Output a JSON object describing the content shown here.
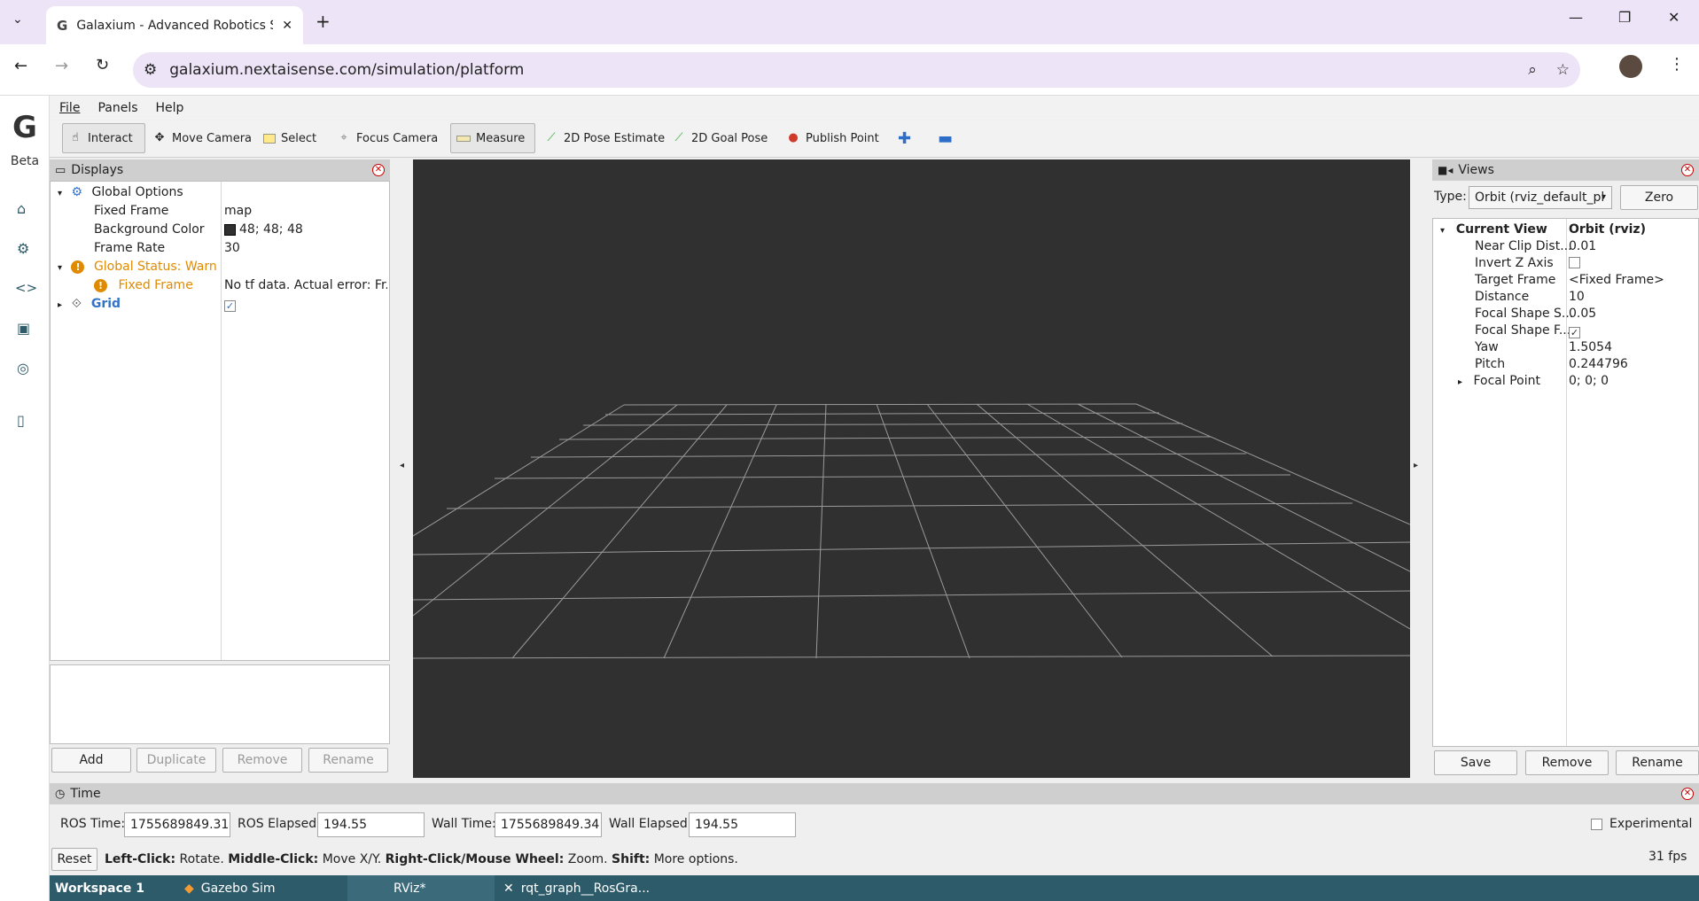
{
  "browser": {
    "tab_title": "Galaxium - Advanced Robotics S",
    "url": "galaxium.nextaisense.com/simulation/platform",
    "new_tab_icon": "plus-icon"
  },
  "rail": {
    "logo": "G",
    "badge": "Beta",
    "icons": [
      "home-icon",
      "gear-icon",
      "code-icon",
      "chip-icon",
      "target-icon",
      "book-icon"
    ]
  },
  "menu": {
    "file": "File",
    "panels": "Panels",
    "help": "Help"
  },
  "tools": {
    "interact": "Interact",
    "move_camera": "Move Camera",
    "select": "Select",
    "focus_camera": "Focus Camera",
    "measure": "Measure",
    "pose_estimate": "2D Pose Estimate",
    "goal_pose": "2D Goal Pose",
    "publish_point": "Publish Point"
  },
  "displays": {
    "title": "Displays",
    "global_options": "Global Options",
    "fixed_frame_label": "Fixed Frame",
    "fixed_frame_value": "map",
    "bg_color_label": "Background Color",
    "bg_color_value": "48; 48; 48",
    "bg_color_swatch": "#303030",
    "frame_rate_label": "Frame Rate",
    "frame_rate_value": "30",
    "global_status": "Global Status: Warn",
    "status_fixed_frame": "Fixed Frame",
    "status_error": "No tf data.  Actual error: Fr...",
    "grid": "Grid",
    "grid_checked": "✓",
    "buttons": {
      "add": "Add",
      "duplicate": "Duplicate",
      "remove": "Remove",
      "rename": "Rename"
    }
  },
  "views": {
    "title": "Views",
    "type_label": "Type:",
    "type_value": "Orbit (rviz_default_pl",
    "zero": "Zero",
    "current_view": "Current View",
    "current_view_type": "Orbit (rviz)",
    "props": [
      {
        "label": "Near Clip Dist...",
        "value": "0.01"
      },
      {
        "label": "Invert Z Axis",
        "value": ""
      },
      {
        "label": "Target Frame",
        "value": "<Fixed Frame>"
      },
      {
        "label": "Distance",
        "value": "10"
      },
      {
        "label": "Focal Shape S...",
        "value": "0.05"
      },
      {
        "label": "Focal Shape F...",
        "value": "✓"
      },
      {
        "label": "Yaw",
        "value": "1.5054"
      },
      {
        "label": "Pitch",
        "value": "0.244796"
      },
      {
        "label": "Focal Point",
        "value": "0; 0; 0"
      }
    ],
    "buttons": {
      "save": "Save",
      "remove": "Remove",
      "rename": "Rename"
    }
  },
  "time": {
    "title": "Time",
    "ros_time_label": "ROS Time:",
    "ros_time": "1755689849.31",
    "ros_elapsed_label": "ROS Elapsed:",
    "ros_elapsed": "194.55",
    "wall_time_label": "Wall Time:",
    "wall_time": "1755689849.34",
    "wall_elapsed_label": "Wall Elapsed:",
    "wall_elapsed": "194.55",
    "experimental": "Experimental"
  },
  "status": {
    "reset": "Reset",
    "left_click": "Left-Click:",
    "left_click_desc": " Rotate. ",
    "middle_click": "Middle-Click:",
    "middle_click_desc": " Move X/Y. ",
    "right_click": "Right-Click/Mouse Wheel:",
    "right_click_desc": " Zoom. ",
    "shift": "Shift:",
    "shift_desc": " More options.",
    "fps": "31 fps"
  },
  "taskbar": {
    "workspace": "Workspace 1",
    "items": [
      "Gazebo Sim",
      "RViz*",
      "rqt_graph__RosGra..."
    ]
  }
}
